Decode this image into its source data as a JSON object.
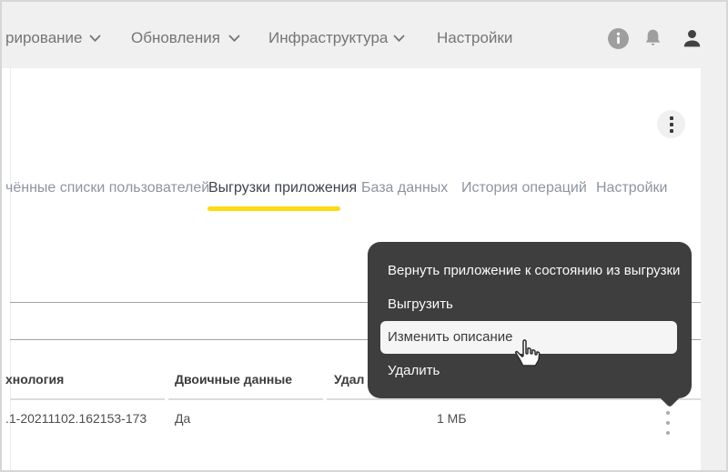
{
  "navbar": {
    "items": [
      {
        "label": "рирование",
        "has_dropdown": true
      },
      {
        "label": "Обновления",
        "has_dropdown": true
      },
      {
        "label": "Инфраструктура",
        "has_dropdown": true
      },
      {
        "label": "Настройки",
        "has_dropdown": false
      }
    ],
    "icons": [
      "info",
      "notifications",
      "user"
    ]
  },
  "tabs": [
    {
      "label": "чённые списки пользователей",
      "active": false
    },
    {
      "label": "Выгрузки приложения",
      "active": true
    },
    {
      "label": "База данных",
      "active": false
    },
    {
      "label": "История операций",
      "active": false
    },
    {
      "label": "Настройки",
      "active": false
    }
  ],
  "context_menu": {
    "items": [
      {
        "label": "Вернуть приложение к состоянию из выгрузки",
        "highlighted": false
      },
      {
        "label": "Выгрузить",
        "highlighted": false
      },
      {
        "label": "Изменить описание",
        "highlighted": true
      },
      {
        "label": "Удалить",
        "highlighted": false
      }
    ]
  },
  "table": {
    "headers": [
      "хнология",
      "Двоичные данные",
      "Удал"
    ],
    "rows": [
      [
        ".1-20211102.162153-173",
        "Да",
        "1 МБ"
      ]
    ]
  },
  "colors": {
    "accent_underline": "#ffd912",
    "menu_background": "#3e3e3e",
    "navbar_background": "#f0f0f0"
  }
}
